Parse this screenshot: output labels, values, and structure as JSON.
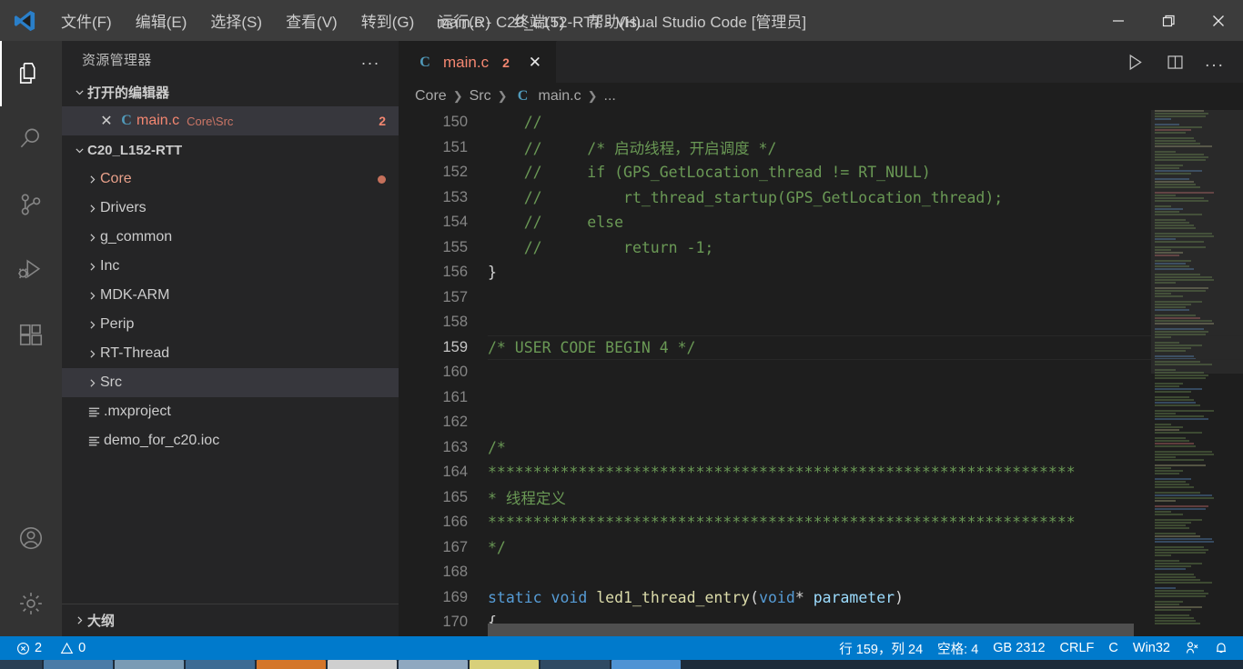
{
  "window": {
    "title": "main.c - C20_L152-RTT - Visual Studio Code [管理员]",
    "minimize_label": "—",
    "maximize_label": "❐",
    "close_label": "✕",
    "accent_color": "#007acc",
    "titlebar_color": "#3c3c3c"
  },
  "menubar": {
    "items": [
      {
        "label": "文件(F)",
        "name": "menu-file"
      },
      {
        "label": "编辑(E)",
        "name": "menu-edit"
      },
      {
        "label": "选择(S)",
        "name": "menu-selection"
      },
      {
        "label": "查看(V)",
        "name": "menu-view"
      },
      {
        "label": "转到(G)",
        "name": "menu-go"
      },
      {
        "label": "运行(R)",
        "name": "menu-run"
      },
      {
        "label": "终端(T)",
        "name": "menu-terminal"
      },
      {
        "label": "帮助(H)",
        "name": "menu-help"
      }
    ]
  },
  "activitybar": {
    "items": [
      {
        "icon": "files-icon",
        "name": "activity-explorer",
        "active": true
      },
      {
        "icon": "search-icon",
        "name": "activity-search",
        "active": false
      },
      {
        "icon": "source-control-icon",
        "name": "activity-source-control",
        "active": false
      },
      {
        "icon": "run-debug-icon",
        "name": "activity-run-debug",
        "active": false
      },
      {
        "icon": "extensions-icon",
        "name": "activity-extensions",
        "active": false
      }
    ],
    "bottom": [
      {
        "icon": "account-icon",
        "name": "activity-account"
      },
      {
        "icon": "gear-icon",
        "name": "activity-settings"
      }
    ]
  },
  "sidebar": {
    "title": "资源管理器",
    "more_actions": "...",
    "open_editors": {
      "header": "打开的编辑器",
      "items": [
        {
          "name": "main.c",
          "path": "Core\\Src",
          "badge": "2",
          "icon": "c-file-icon",
          "close": "✕"
        }
      ]
    },
    "project": {
      "header": "C20_L152-RTT",
      "items": [
        {
          "label": "Core",
          "type": "folder",
          "dirty": true,
          "selected": false,
          "error": true
        },
        {
          "label": "Drivers",
          "type": "folder",
          "dirty": false,
          "selected": false,
          "error": false
        },
        {
          "label": "g_common",
          "type": "folder",
          "dirty": false,
          "selected": false,
          "error": false
        },
        {
          "label": "Inc",
          "type": "folder",
          "dirty": false,
          "selected": false,
          "error": false
        },
        {
          "label": "MDK-ARM",
          "type": "folder",
          "dirty": false,
          "selected": false,
          "error": false
        },
        {
          "label": "Perip",
          "type": "folder",
          "dirty": false,
          "selected": false,
          "error": false
        },
        {
          "label": "RT-Thread",
          "type": "folder",
          "dirty": false,
          "selected": false,
          "error": false
        },
        {
          "label": "Src",
          "type": "folder",
          "dirty": false,
          "selected": true,
          "error": false
        },
        {
          "label": ".mxproject",
          "type": "file",
          "dirty": false,
          "selected": false,
          "error": false
        },
        {
          "label": "demo_for_c20.ioc",
          "type": "file",
          "dirty": false,
          "selected": false,
          "error": false
        }
      ]
    },
    "outline": {
      "header": "大纲"
    }
  },
  "editor": {
    "tab": {
      "label": "main.c",
      "count": "2",
      "close": "✕",
      "icon": "c-file-icon"
    },
    "actions": [
      {
        "icon": "run-play-icon",
        "name": "run-code-button"
      },
      {
        "icon": "split-editor-icon",
        "name": "split-editor-button"
      },
      {
        "icon": "more-actions-icon",
        "name": "editor-more-actions",
        "label": "..."
      }
    ],
    "breadcrumb": [
      "Core",
      "Src",
      "main.c",
      "..."
    ],
    "breadcrumb_separator": "❯",
    "active_line": 159,
    "lines": [
      {
        "n": "150",
        "tokens": [
          {
            "t": "    //",
            "c": "cmt"
          }
        ]
      },
      {
        "n": "151",
        "tokens": [
          {
            "t": "    //     /* 启动线程，开启调度 */",
            "c": "cmt"
          }
        ]
      },
      {
        "n": "152",
        "tokens": [
          {
            "t": "    //     if (GPS_GetLocation_thread != RT_NULL)",
            "c": "cmt"
          }
        ]
      },
      {
        "n": "153",
        "tokens": [
          {
            "t": "    //         rt_thread_startup(GPS_GetLocation_thread);",
            "c": "cmt"
          }
        ]
      },
      {
        "n": "154",
        "tokens": [
          {
            "t": "    //     else",
            "c": "cmt"
          }
        ]
      },
      {
        "n": "155",
        "tokens": [
          {
            "t": "    //         return -1;",
            "c": "cmt"
          }
        ]
      },
      {
        "n": "156",
        "tokens": [
          {
            "t": "}",
            "c": ""
          }
        ]
      },
      {
        "n": "157",
        "tokens": []
      },
      {
        "n": "158",
        "tokens": []
      },
      {
        "n": "159",
        "tokens": [
          {
            "t": "/* USER CODE BEGIN 4 */",
            "c": "cmt"
          }
        ]
      },
      {
        "n": "160",
        "tokens": []
      },
      {
        "n": "161",
        "tokens": []
      },
      {
        "n": "162",
        "tokens": []
      },
      {
        "n": "163",
        "tokens": [
          {
            "t": "/*",
            "c": "cmt"
          }
        ]
      },
      {
        "n": "164",
        "tokens": [
          {
            "t": "*****************************************************************",
            "c": "cmt"
          }
        ]
      },
      {
        "n": "165",
        "tokens": [
          {
            "t": "* 线程定义",
            "c": "cmt"
          }
        ]
      },
      {
        "n": "166",
        "tokens": [
          {
            "t": "*****************************************************************",
            "c": "cmt"
          }
        ]
      },
      {
        "n": "167",
        "tokens": [
          {
            "t": "*/",
            "c": "cmt"
          }
        ]
      },
      {
        "n": "168",
        "tokens": []
      },
      {
        "n": "169",
        "tokens": [
          {
            "t": "static",
            "c": "kw"
          },
          {
            "t": " ",
            "c": ""
          },
          {
            "t": "void",
            "c": "kw"
          },
          {
            "t": " ",
            "c": ""
          },
          {
            "t": "led1_thread_entry",
            "c": "fn"
          },
          {
            "t": "(",
            "c": ""
          },
          {
            "t": "void",
            "c": "kw"
          },
          {
            "t": "* ",
            "c": ""
          },
          {
            "t": "parameter",
            "c": "var"
          },
          {
            "t": ")",
            "c": ""
          }
        ]
      },
      {
        "n": "170",
        "tokens": [
          {
            "t": "{",
            "c": ""
          }
        ]
      }
    ]
  },
  "statusbar": {
    "left": [
      {
        "icon": "error-icon",
        "value": "2",
        "name": "status-errors"
      },
      {
        "icon": "warning-icon",
        "value": "0",
        "name": "status-warnings"
      }
    ],
    "right": [
      {
        "label": "行 159，列 24",
        "name": "status-cursor-position"
      },
      {
        "label": "空格: 4",
        "name": "status-indentation"
      },
      {
        "label": "GB 2312",
        "name": "status-encoding"
      },
      {
        "label": "CRLF",
        "name": "status-eol"
      },
      {
        "label": "C",
        "name": "status-language-mode"
      },
      {
        "label": "Win32",
        "name": "status-platform"
      },
      {
        "icon": "broadcast-icon",
        "label": "",
        "name": "status-live-share"
      },
      {
        "icon": "bell-icon",
        "label": "",
        "name": "status-notifications"
      }
    ]
  },
  "taskbar": {
    "items": [
      "item-1",
      "item-2",
      "item-3",
      "item-4",
      "item-5",
      "item-6",
      "item-7",
      "item-8",
      "item-9"
    ]
  },
  "colors": {
    "comment": "#6A9955",
    "keyword": "#569cd6",
    "function": "#dcdcaa",
    "variable": "#9cdcfe",
    "error": "#f48771",
    "editor_bg": "#1e1e1e",
    "sidebar_bg": "#252526",
    "activitybar_bg": "#333333"
  }
}
